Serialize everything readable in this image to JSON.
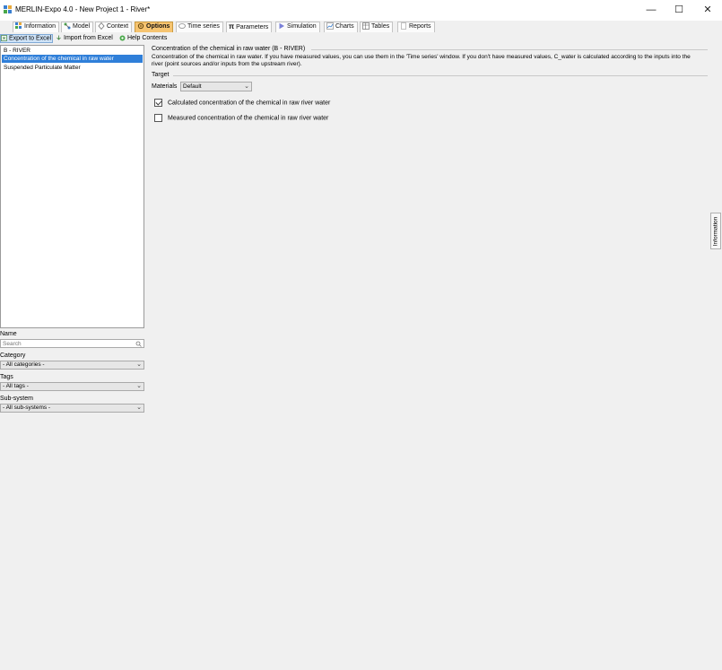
{
  "window": {
    "title": "MERLIN-Expo 4.0 - New Project 1 - River*",
    "minimize_glyph": "—",
    "maximize_glyph": "☐",
    "close_glyph": "✕"
  },
  "tabs": [
    {
      "label": "Information",
      "icon": "information-icon"
    },
    {
      "label": "Model",
      "icon": "model-icon"
    },
    {
      "label": "Context",
      "icon": "context-icon"
    },
    {
      "label": "Options",
      "icon": "options-icon",
      "active": true
    },
    {
      "label": "Time series",
      "icon": "time-series-icon"
    },
    {
      "label": "Parameters",
      "icon": "pi-icon",
      "glyph": "π"
    },
    {
      "label": "Simulation",
      "icon": "play-icon"
    },
    {
      "label": "Charts",
      "icon": "chart-icon"
    },
    {
      "label": "Tables",
      "icon": "table-icon"
    },
    {
      "label": "Reports",
      "icon": "report-icon"
    }
  ],
  "toolbar": {
    "export_label": "Export to Excel",
    "import_label": "Import from Excel",
    "help_label": "Help Contents"
  },
  "tree": {
    "root": "B - RIVER",
    "items": [
      {
        "label": "Concentration of the chemical in raw water",
        "selected": true
      },
      {
        "label": "Suspended Particulate Matter",
        "selected": false
      }
    ]
  },
  "filters": {
    "name_label": "Name",
    "search_placeholder": "Search",
    "category_label": "Category",
    "category_value": "- All categories -",
    "tags_label": "Tags",
    "tags_value": "- All tags -",
    "subsystem_label": "Sub-system",
    "subsystem_value": "- All sub-systems -"
  },
  "content": {
    "section_title": "Concentration of the chemical in raw water (B - RIVER)",
    "description": "Concentration of the chemical in raw water. If you have measured values, you can use them in the 'Time series' window. If you don't have measured values, C_water is calculated according to the inputs into the river (point sources and/or inputs from the upstream river).",
    "target_label": "Target",
    "materials_label": "Materials",
    "materials_value": "Default",
    "checkbox_calculated": "Calculated concentration of the chemical in raw river water",
    "checkbox_measured": "Measured concentration of the chemical in raw river water"
  },
  "side_tab": {
    "label": "Information"
  },
  "colors": {
    "active_tab": "#f6c470",
    "selection": "#2f7fd9",
    "highlight_button": "#cfe3f7"
  }
}
